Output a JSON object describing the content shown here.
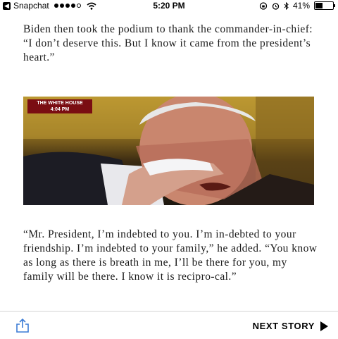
{
  "status_bar": {
    "app": "Snapchat",
    "time": "5:20 PM",
    "battery": "41%",
    "battery_level": 0.41
  },
  "article": {
    "paragraph1": "Biden then took the podium to thank the commander-in-chief: “I don’t deserve this. But I know it came from the president’s heart.”",
    "paragraph2": "“Mr. President, I’m indebted to you. I’m in-debted to your friendship. I’m indebted to your family,” he added. “You know as long as there is breath in me, I’ll be there for you, my family will be there. I know it is recipro-cal.”"
  },
  "image": {
    "chyron_title": "THE WHITE HOUSE",
    "chyron_time": "4:04 PM"
  },
  "bottom_bar": {
    "next_label": "NEXT STORY",
    "share_icon": "share-icon",
    "next_icon": "play-arrow-icon"
  }
}
